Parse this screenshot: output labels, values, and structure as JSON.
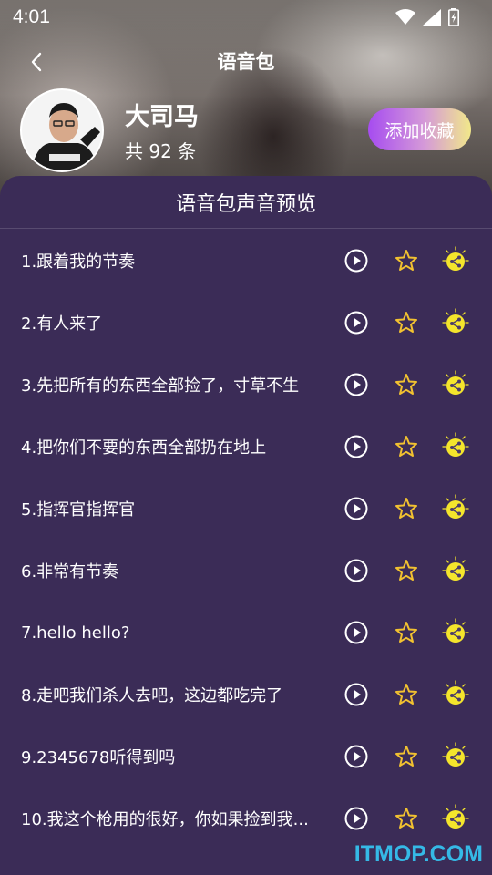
{
  "status": {
    "time": "4:01"
  },
  "nav": {
    "title": "语音包"
  },
  "profile": {
    "name": "大司马",
    "count_text": "共 92 条",
    "add_favorite_label": "添加收藏"
  },
  "panel": {
    "title": "语音包声音预览"
  },
  "items": [
    {
      "label": "1.跟着我的节奏"
    },
    {
      "label": "2.有人来了"
    },
    {
      "label": "3.先把所有的东西全部捡了，寸草不生"
    },
    {
      "label": "4.把你们不要的东西全部扔在地上"
    },
    {
      "label": "5.指挥官指挥官"
    },
    {
      "label": "6.非常有节奏"
    },
    {
      "label": "7.hello hello?"
    },
    {
      "label": "8.走吧我们杀人去吧，这边都吃完了"
    },
    {
      "label": "9.2345678听得到吗"
    },
    {
      "label": "10.我这个枪用的很好，你如果捡到我..."
    }
  ],
  "watermark": "ITMOP.COM",
  "icons": {
    "back": "chevron-left-icon",
    "play": "play-circle-icon",
    "favorite": "star-outline-icon",
    "share": "share-icon"
  },
  "colors": {
    "panel_bg": "#3b2c57",
    "star": "#f2c230",
    "share_bg": "#f4e52c",
    "watermark": "#35b9e6"
  }
}
